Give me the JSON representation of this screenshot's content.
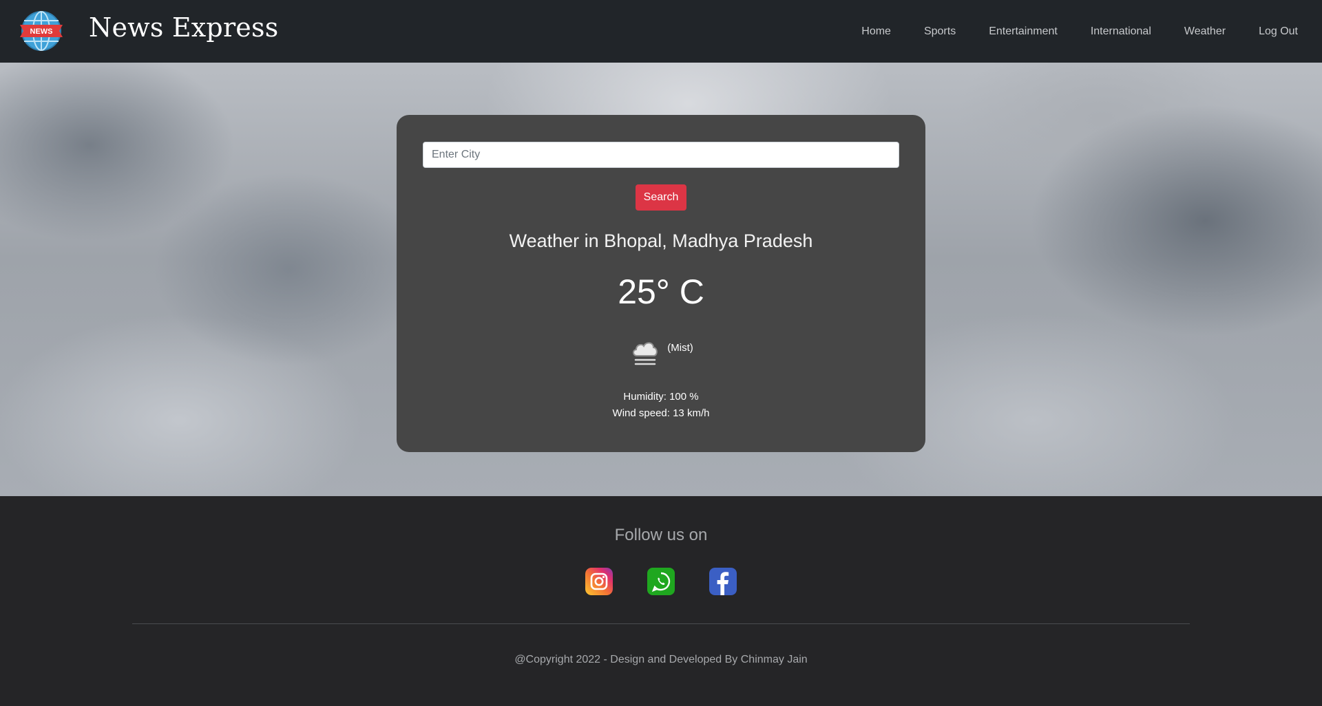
{
  "navbar": {
    "logo_text": "NEWS",
    "brand": "News Express",
    "links": [
      "Home",
      "Sports",
      "Entertainment",
      "International",
      "Weather",
      "Log Out"
    ]
  },
  "weather": {
    "input_placeholder": "Enter City",
    "input_value": "",
    "search_label": "Search",
    "heading": "Weather in Bhopal, Madhya Pradesh",
    "temperature": "25° C",
    "condition_icon": "mist-cloud-icon",
    "condition": "(Mist)",
    "humidity": "Humidity: 100 %",
    "wind": "Wind speed: 13 km/h"
  },
  "footer": {
    "follow_title": "Follow us on",
    "socials": [
      "instagram-icon",
      "whatsapp-icon",
      "facebook-icon"
    ],
    "copyright": "@Copyright 2022 - Design and Developed By Chinmay Jain"
  },
  "colors": {
    "navbar_bg": "#212529",
    "card_bg": "#464646",
    "search_button": "#dc3545",
    "footer_bg": "#252527"
  }
}
